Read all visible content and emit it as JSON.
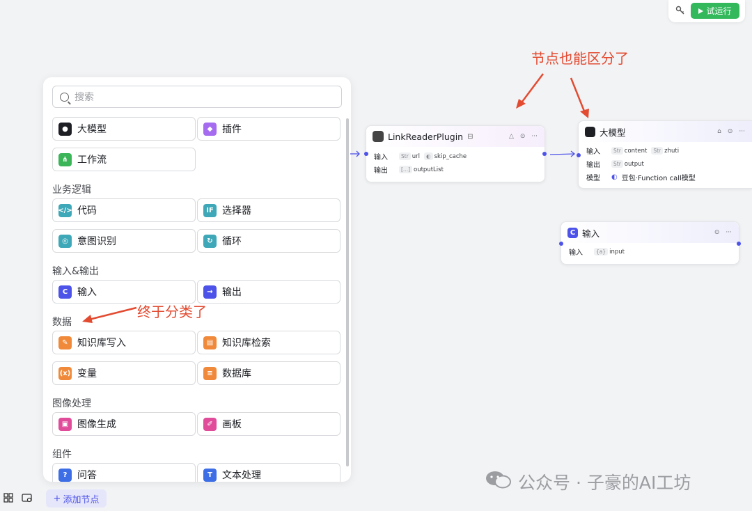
{
  "toolbar": {
    "run_label": "试运行",
    "key_icon": "key-icon",
    "play_icon": "play-icon"
  },
  "panel": {
    "search_placeholder": "搜索",
    "top_items": [
      {
        "label": "大模型",
        "icon": "llm-icon",
        "color": "#1d1f24"
      },
      {
        "label": "插件",
        "icon": "cube-icon",
        "color": "#a56cf0"
      },
      {
        "label": "工作流",
        "icon": "workflow-icon",
        "color": "#3cb559"
      }
    ],
    "sections": [
      {
        "title": "业务逻辑",
        "items": [
          {
            "label": "代码",
            "icon": "code-icon",
            "color": "#3fa8b8"
          },
          {
            "label": "选择器",
            "icon": "if-icon",
            "color": "#3fa8b8"
          },
          {
            "label": "意图识别",
            "icon": "intent-icon",
            "color": "#3fa8b8"
          },
          {
            "label": "循环",
            "icon": "loop-icon",
            "color": "#3fa8b8"
          }
        ]
      },
      {
        "title": "输入&输出",
        "items": [
          {
            "label": "输入",
            "icon": "input-icon",
            "color": "#4d53e8"
          },
          {
            "label": "输出",
            "icon": "output-icon",
            "color": "#4d53e8"
          }
        ]
      },
      {
        "title": "数据",
        "items": [
          {
            "label": "知识库写入",
            "icon": "kb-write-icon",
            "color": "#f08a3a"
          },
          {
            "label": "知识库检索",
            "icon": "kb-search-icon",
            "color": "#f08a3a"
          },
          {
            "label": "变量",
            "icon": "variable-icon",
            "color": "#f08a3a"
          },
          {
            "label": "数据库",
            "icon": "database-icon",
            "color": "#f08a3a"
          }
        ]
      },
      {
        "title": "图像处理",
        "items": [
          {
            "label": "图像生成",
            "icon": "image-gen-icon",
            "color": "#e04b9a"
          },
          {
            "label": "画板",
            "icon": "canvas-icon",
            "color": "#e04b9a"
          }
        ]
      },
      {
        "title": "组件",
        "items": [
          {
            "label": "问答",
            "icon": "qa-icon",
            "color": "#3d6ee6"
          },
          {
            "label": "文本处理",
            "icon": "text-process-icon",
            "color": "#3d6ee6"
          }
        ]
      }
    ]
  },
  "bottom_bar": {
    "add_node_label": "添加节点"
  },
  "nodes": {
    "plugin": {
      "title": "LinkReaderPlugin",
      "input_label": "输入",
      "output_label": "输出",
      "inputs": [
        {
          "type": "Str",
          "name": "url"
        },
        {
          "type": "◐",
          "name": "skip_cache"
        }
      ],
      "outputs": [
        {
          "type": "[...]",
          "name": "outputList"
        }
      ]
    },
    "llm": {
      "title": "大模型",
      "input_label": "输入",
      "output_label": "输出",
      "model_label": "模型",
      "inputs": [
        {
          "type": "Str",
          "name": "content"
        },
        {
          "type": "Str",
          "name": "zhuti"
        }
      ],
      "outputs": [
        {
          "type": "Str",
          "name": "output"
        }
      ],
      "model": "豆包·Function call模型"
    },
    "input": {
      "title": "输入",
      "input_label": "输入",
      "inputs": [
        {
          "type": "{a}",
          "name": "input"
        }
      ]
    }
  },
  "annotations": {
    "nodes_note": "节点也能区分了",
    "category_note": "终于分类了"
  },
  "watermark": "公众号 · 子豪的AI工坊"
}
